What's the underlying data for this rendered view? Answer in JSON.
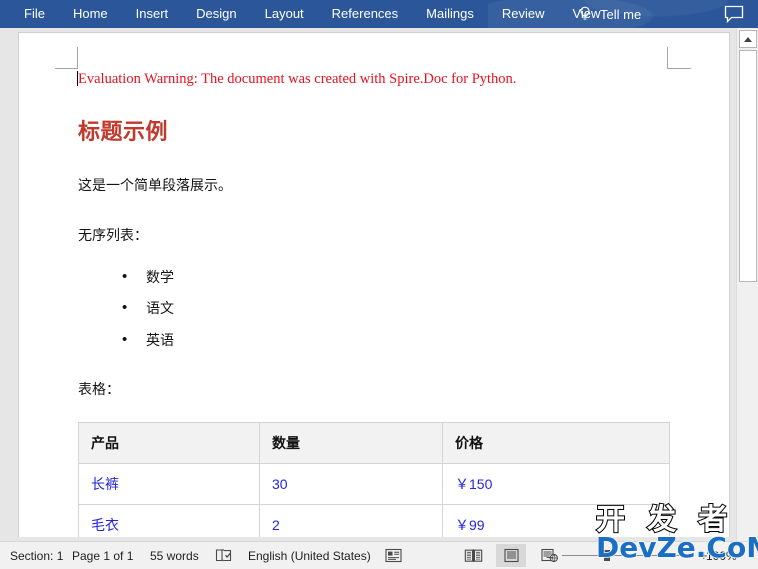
{
  "ribbon": {
    "tabs": [
      {
        "label": "File"
      },
      {
        "label": "Home"
      },
      {
        "label": "Insert"
      },
      {
        "label": "Design"
      },
      {
        "label": "Layout"
      },
      {
        "label": "References"
      },
      {
        "label": "Mailings"
      },
      {
        "label": "Review"
      },
      {
        "label": "View"
      }
    ],
    "tell_me": "Tell me",
    "accent_color": "#2b579a"
  },
  "document": {
    "evaluation_warning": "Evaluation Warning: The document was created with Spire.Doc for Python.",
    "heading": "标题示例",
    "heading_color": "#c0392b",
    "paragraph": "这是一个简单段落展示。",
    "list_label": "无序列表：",
    "list_items": [
      "数学",
      "语文",
      "英语"
    ],
    "table_label": "表格：",
    "table": {
      "headers": [
        "产品",
        "数量",
        "价格"
      ],
      "rows": [
        [
          "长裤",
          "30",
          "￥150"
        ],
        [
          "毛衣",
          "2",
          "￥99"
        ]
      ],
      "header_bg": "#f2f2f2",
      "cell_text_color": "#2427d9"
    }
  },
  "status_bar": {
    "section": "Section: 1",
    "page": "Page 1 of 1",
    "words": "55 words",
    "language": "English (United States)",
    "zoom_percent": "100%"
  },
  "watermark": {
    "line1": "开 发 者",
    "line2": "DevZe.CoM",
    "line2_color": "#1a6fc4"
  }
}
